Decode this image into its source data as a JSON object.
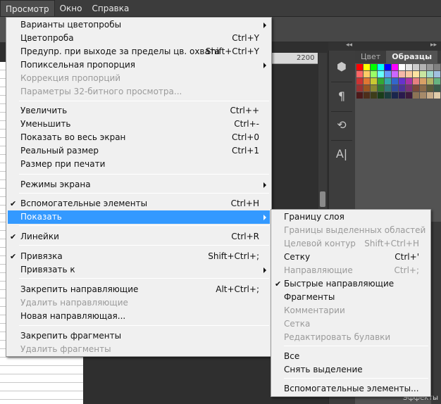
{
  "menubar": {
    "items": [
      {
        "label": "Просмотр",
        "active": true
      },
      {
        "label": "Окно",
        "active": false
      },
      {
        "label": "Справка",
        "active": false
      }
    ]
  },
  "ruler": {
    "label": "2200"
  },
  "panel": {
    "tabs": [
      {
        "label": "Цвет",
        "active": false
      },
      {
        "label": "Образцы",
        "active": true
      }
    ],
    "swatches": [
      "#ff0000",
      "#ffff00",
      "#00ff00",
      "#00ffff",
      "#0000ff",
      "#ff00ff",
      "#ffffff",
      "#e6e6e6",
      "#cccccc",
      "#b3b3b3",
      "#999999",
      "#808080",
      "#ff6666",
      "#ffcc66",
      "#99ff66",
      "#66ffff",
      "#6699ff",
      "#cc66ff",
      "#f5b8a8",
      "#f9c9a0",
      "#fde3a0",
      "#c9e6a0",
      "#a0d9c9",
      "#a0c0e0",
      "#cc3333",
      "#e07733",
      "#c8c833",
      "#33a833",
      "#33a8a8",
      "#3366cc",
      "#6633cc",
      "#a833a8",
      "#e68080",
      "#d9a066",
      "#b3b366",
      "#66b380",
      "#993333",
      "#995522",
      "#888833",
      "#337733",
      "#337777",
      "#334d99",
      "#4d3399",
      "#773377",
      "#7a4a3a",
      "#8a6a4a",
      "#5a5a3a",
      "#3a5a4a",
      "#4d1a1a",
      "#4d2e1a",
      "#3d3d1a",
      "#1a3d1a",
      "#1a3d3d",
      "#1a264d",
      "#2a1a4d",
      "#3d1a3d",
      "#8c7355",
      "#a68a6a",
      "#c9ad8a",
      "#e0ccaa"
    ]
  },
  "status": {
    "effects_label": "Эффекты"
  },
  "view_menu": {
    "items": [
      {
        "label": "Варианты цветопробы",
        "shortcut": "",
        "submenu": true,
        "disabled": false,
        "checked": false
      },
      {
        "label": "Цветопроба",
        "shortcut": "Ctrl+Y",
        "submenu": false,
        "disabled": false,
        "checked": false
      },
      {
        "label": "Предупр. при выходе за пределы цв. охвата",
        "shortcut": "Shift+Ctrl+Y",
        "submenu": false,
        "disabled": false,
        "checked": false
      },
      {
        "label": "Попиксельная пропорция",
        "shortcut": "",
        "submenu": true,
        "disabled": false,
        "checked": false
      },
      {
        "label": "Коррекция пропорций",
        "shortcut": "",
        "submenu": false,
        "disabled": true,
        "checked": false
      },
      {
        "label": "Параметры 32-битного просмотра...",
        "shortcut": "",
        "submenu": false,
        "disabled": true,
        "checked": false
      },
      {
        "label": "Увеличить",
        "shortcut": "Ctrl++",
        "submenu": false,
        "disabled": false,
        "checked": false
      },
      {
        "label": "Уменьшить",
        "shortcut": "Ctrl+-",
        "submenu": false,
        "disabled": false,
        "checked": false
      },
      {
        "label": "Показать во весь экран",
        "shortcut": "Ctrl+0",
        "submenu": false,
        "disabled": false,
        "checked": false
      },
      {
        "label": "Реальный размер",
        "shortcut": "Ctrl+1",
        "submenu": false,
        "disabled": false,
        "checked": false
      },
      {
        "label": "Размер при печати",
        "shortcut": "",
        "submenu": false,
        "disabled": false,
        "checked": false
      },
      {
        "label": "Режимы экрана",
        "shortcut": "",
        "submenu": true,
        "disabled": false,
        "checked": false
      },
      {
        "label": "Вспомогательные элементы",
        "shortcut": "Ctrl+H",
        "submenu": false,
        "disabled": false,
        "checked": true
      },
      {
        "label": "Показать",
        "shortcut": "",
        "submenu": true,
        "disabled": false,
        "checked": false,
        "highlighted": true
      },
      {
        "label": "Линейки",
        "shortcut": "Ctrl+R",
        "submenu": false,
        "disabled": false,
        "checked": true
      },
      {
        "label": "Привязка",
        "shortcut": "Shift+Ctrl+;",
        "submenu": false,
        "disabled": false,
        "checked": true
      },
      {
        "label": "Привязать к",
        "shortcut": "",
        "submenu": true,
        "disabled": false,
        "checked": false
      },
      {
        "label": "Закрепить направляющие",
        "shortcut": "Alt+Ctrl+;",
        "submenu": false,
        "disabled": false,
        "checked": false
      },
      {
        "label": "Удалить направляющие",
        "shortcut": "",
        "submenu": false,
        "disabled": true,
        "checked": false
      },
      {
        "label": "Новая направляющая...",
        "shortcut": "",
        "submenu": false,
        "disabled": false,
        "checked": false
      },
      {
        "label": "Закрепить фрагменты",
        "shortcut": "",
        "submenu": false,
        "disabled": false,
        "checked": false
      },
      {
        "label": "Удалить фрагменты",
        "shortcut": "",
        "submenu": false,
        "disabled": true,
        "checked": false
      }
    ]
  },
  "show_submenu": {
    "items": [
      {
        "label": "Границу слоя",
        "shortcut": "",
        "disabled": false,
        "checked": false
      },
      {
        "label": "Границы выделенных областей",
        "shortcut": "",
        "disabled": true,
        "checked": false
      },
      {
        "label": "Целевой контур",
        "shortcut": "Shift+Ctrl+H",
        "disabled": true,
        "checked": false
      },
      {
        "label": "Сетку",
        "shortcut": "Ctrl+'",
        "disabled": false,
        "checked": false
      },
      {
        "label": "Направляющие",
        "shortcut": "Ctrl+;",
        "disabled": true,
        "checked": false
      },
      {
        "label": "Быстрые направляющие",
        "shortcut": "",
        "disabled": false,
        "checked": true
      },
      {
        "label": "Фрагменты",
        "shortcut": "",
        "disabled": false,
        "checked": false
      },
      {
        "label": "Комментарии",
        "shortcut": "",
        "disabled": true,
        "checked": false
      },
      {
        "label": "Сетка",
        "shortcut": "",
        "disabled": true,
        "checked": false
      },
      {
        "label": "Редактировать булавки",
        "shortcut": "",
        "disabled": true,
        "checked": false
      },
      {
        "label": "Все",
        "shortcut": "",
        "disabled": false,
        "checked": false
      },
      {
        "label": "Снять выделение",
        "shortcut": "",
        "disabled": false,
        "checked": false
      },
      {
        "label": "Вспомогательные элементы...",
        "shortcut": "",
        "disabled": false,
        "checked": false
      }
    ]
  },
  "check_glyph": "✔"
}
